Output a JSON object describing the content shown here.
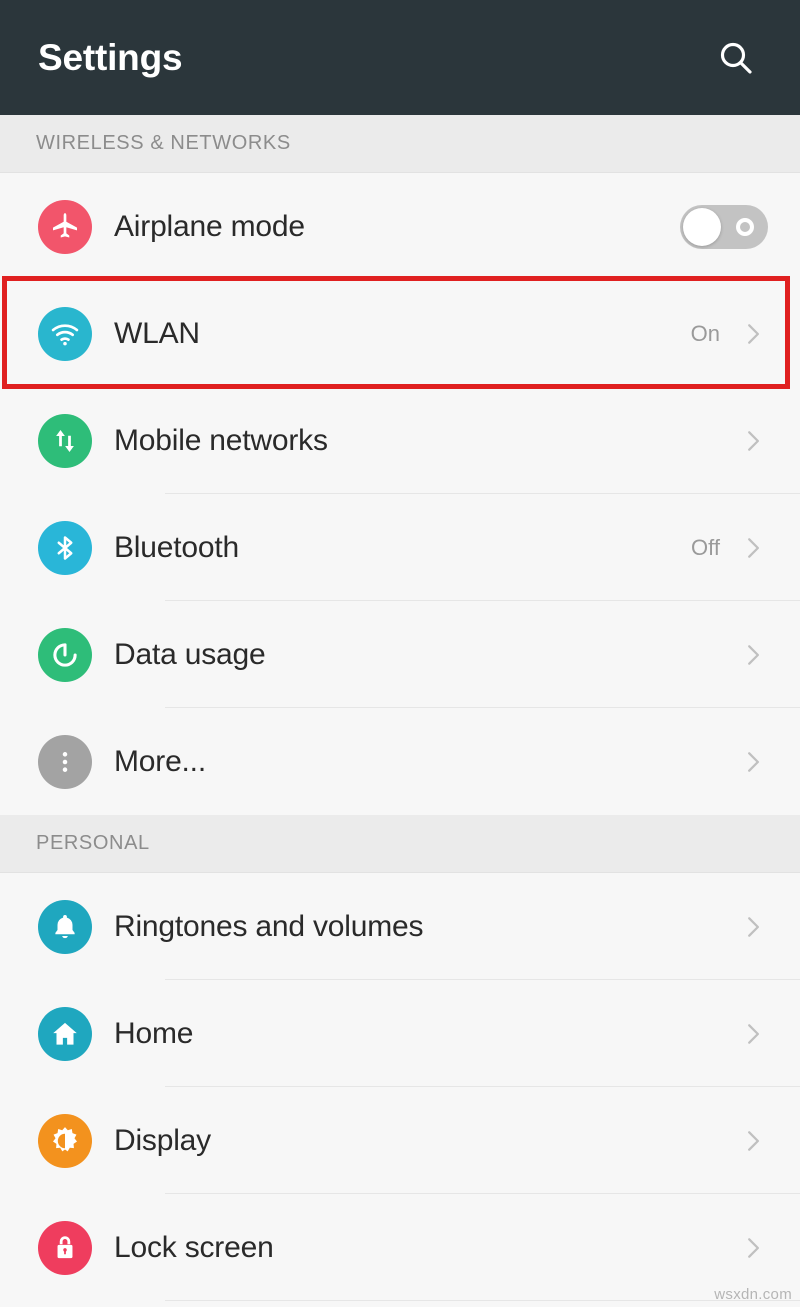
{
  "header": {
    "title": "Settings",
    "search_icon": "search-icon",
    "background": "#2b363b",
    "title_color": "#ffffff"
  },
  "highlight": {
    "target": "WLAN",
    "color": "#e02020"
  },
  "sections": [
    {
      "id": "wireless-networks",
      "label": "WIRELESS & NETWORKS",
      "rows": [
        {
          "id": "airplane-mode",
          "label": "Airplane mode",
          "icon": "airplane-icon",
          "icon_color": "#f2556b",
          "control": "toggle",
          "toggle_on": false,
          "value": "",
          "divider": false
        },
        {
          "id": "wlan",
          "label": "WLAN",
          "icon": "wifi-icon",
          "icon_color": "#29b6ce",
          "control": "chevron",
          "value": "On",
          "divider": false,
          "highlighted": true
        },
        {
          "id": "mobile-networks",
          "label": "Mobile networks",
          "icon": "data-transfer-icon",
          "icon_color": "#2ebd79",
          "control": "chevron",
          "value": "",
          "divider": true
        },
        {
          "id": "bluetooth",
          "label": "Bluetooth",
          "icon": "bluetooth-icon",
          "icon_color": "#29b6d8",
          "control": "chevron",
          "value": "Off",
          "divider": true
        },
        {
          "id": "data-usage",
          "label": "Data usage",
          "icon": "data-usage-icon",
          "icon_color": "#2ebd79",
          "control": "chevron",
          "value": "",
          "divider": true
        },
        {
          "id": "more",
          "label": "More...",
          "icon": "overflow-dots-icon",
          "icon_color": "#a3a3a3",
          "control": "chevron",
          "value": "",
          "divider": false
        }
      ]
    },
    {
      "id": "personal",
      "label": "PERSONAL",
      "rows": [
        {
          "id": "ringtones-and-volumes",
          "label": "Ringtones and volumes",
          "icon": "bell-icon",
          "icon_color": "#1fa7bf",
          "control": "chevron",
          "value": "",
          "divider": true
        },
        {
          "id": "home",
          "label": "Home",
          "icon": "home-icon",
          "icon_color": "#1fa7bf",
          "control": "chevron",
          "value": "",
          "divider": true
        },
        {
          "id": "display",
          "label": "Display",
          "icon": "brightness-icon",
          "icon_color": "#f3921e",
          "control": "chevron",
          "value": "",
          "divider": true
        },
        {
          "id": "lock-screen",
          "label": "Lock screen",
          "icon": "lock-icon",
          "icon_color": "#ef3d5e",
          "control": "chevron",
          "value": "",
          "divider": true
        }
      ]
    }
  ],
  "watermark": "wsxdn.com"
}
